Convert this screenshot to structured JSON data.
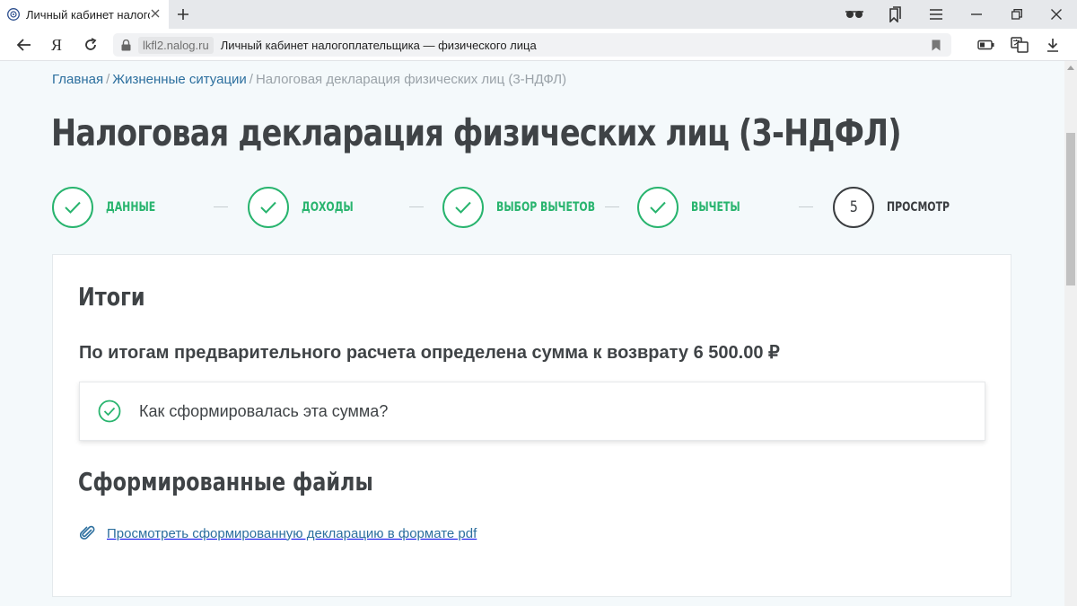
{
  "browser": {
    "tab_title": "Личный кабинет налогоплательщика",
    "domain": "lkfl2.nalog.ru",
    "page_title": "Личный кабинет налогоплательщика — физического лица",
    "nav_home": "Я"
  },
  "breadcrumb": {
    "items": [
      "Главная",
      "Жизненные ситуации"
    ],
    "current": "Налоговая декларация физических лиц (3-НДФЛ)",
    "separator": "/"
  },
  "page": {
    "title": "Налоговая декларация физических лиц (3-НДФЛ)"
  },
  "steps": [
    {
      "label": "ДАННЫЕ",
      "status": "done"
    },
    {
      "label": "ДОХОДЫ",
      "status": "done"
    },
    {
      "label": "ВЫБОР ВЫЧЕТОВ",
      "status": "done"
    },
    {
      "label": "ВЫЧЕТЫ",
      "status": "done"
    },
    {
      "label": "ПРОСМОТР",
      "number": "5",
      "status": "current"
    }
  ],
  "card": {
    "results_title": "Итоги",
    "summary": "По итогам предварительного расчета определена сумма к возврату 6 500.00 ₽",
    "accordion_label": "Как сформировалась эта сумма?",
    "files_title": "Сформированные файлы",
    "file_link": "Просмотреть сформированную декларацию в формате pdf"
  },
  "colors": {
    "accent_green": "#28b46e",
    "link_blue": "#2c6f9e",
    "text_dark": "#3f4346",
    "page_bg": "#f4f9fb"
  }
}
